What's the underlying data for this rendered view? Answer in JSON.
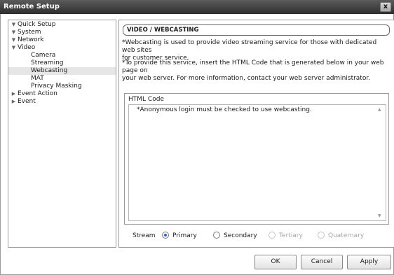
{
  "window": {
    "title": "Remote Setup",
    "close_label": "x"
  },
  "tree": {
    "items": [
      {
        "label": "Quick Setup",
        "level": 0,
        "expanded": true,
        "selected": false
      },
      {
        "label": "System",
        "level": 0,
        "expanded": true,
        "selected": false
      },
      {
        "label": "Network",
        "level": 0,
        "expanded": true,
        "selected": false
      },
      {
        "label": "Video",
        "level": 0,
        "expanded": true,
        "selected": false
      },
      {
        "label": "Camera",
        "level": 1,
        "selected": false
      },
      {
        "label": "Streaming",
        "level": 1,
        "selected": false
      },
      {
        "label": "Webcasting",
        "level": 1,
        "selected": true
      },
      {
        "label": "MAT",
        "level": 1,
        "selected": false
      },
      {
        "label": "Privacy Masking",
        "level": 1,
        "selected": false
      },
      {
        "label": "Event Action",
        "level": 0,
        "expanded": false,
        "selected": false
      },
      {
        "label": "Event",
        "level": 0,
        "expanded": false,
        "selected": false
      }
    ]
  },
  "content": {
    "section_title": "VIDEO / WEBCASTING",
    "desc1_line1": "*Webcasting is used to provide video streaming service for those with dedicated web sites",
    "desc1_line2": "for customer service.",
    "desc2_line1": "*To provide this service, insert the HTML Code that is generated  below in your web page on",
    "desc2_line2": "your web server. For more information, contact your web server administrator.",
    "html_code_label": "HTML Code",
    "html_code_text": "*Anonymous login must be checked to use webcasting.",
    "stream_label": "Stream",
    "stream_options": [
      {
        "label": "Primary",
        "checked": true,
        "disabled": false
      },
      {
        "label": "Secondary",
        "checked": false,
        "disabled": false
      },
      {
        "label": "Tertiary",
        "checked": false,
        "disabled": true
      },
      {
        "label": "Quaternary",
        "checked": false,
        "disabled": true
      }
    ]
  },
  "buttons": {
    "ok": "OK",
    "cancel": "Cancel",
    "apply": "Apply"
  }
}
